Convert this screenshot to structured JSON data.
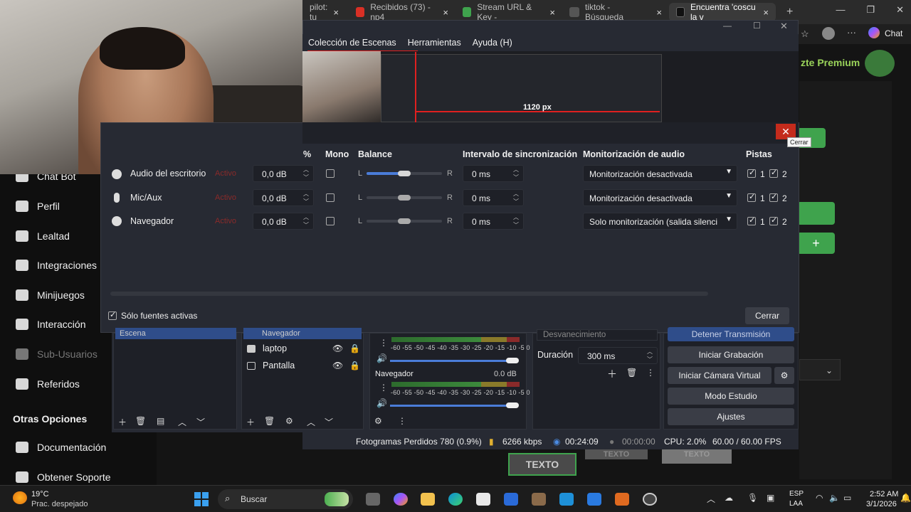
{
  "browser": {
    "tabs": [
      {
        "label": "pilot: tu",
        "active": false
      },
      {
        "label": "Recibidos (73) - np4",
        "active": false
      },
      {
        "label": "Stream URL & Key -",
        "active": false
      },
      {
        "label": "tiktok - Búsqueda",
        "active": false
      },
      {
        "label": "Encuentra 'coscu la v",
        "active": true
      }
    ],
    "new_tab": "+",
    "chat_label": "Chat"
  },
  "site": {
    "premium_label": "zte Premium",
    "sidebar": [
      {
        "label": "Chat Bot",
        "icon": "robot-icon"
      },
      {
        "label": "Perfil",
        "icon": "profile-icon"
      },
      {
        "label": "Lealtad",
        "icon": "trophy-icon"
      },
      {
        "label": "Integraciones",
        "icon": "integrations-icon"
      },
      {
        "label": "Minijuegos",
        "icon": "gamepad-icon"
      },
      {
        "label": "Interacción",
        "icon": "interaction-icon"
      },
      {
        "label": "Sub-Usuarios",
        "icon": "users-icon"
      },
      {
        "label": "Referidos",
        "icon": "referrals-icon"
      }
    ],
    "other_options_heading": "Otras Opciones",
    "other_options": [
      {
        "label": "Documentación",
        "icon": "docs-icon"
      },
      {
        "label": "Obtener Soporte",
        "icon": "help-icon"
      }
    ],
    "texto_buttons": [
      "TEXTO",
      "TEXTO",
      "TEXTO"
    ]
  },
  "obs": {
    "menu": [
      "Colección de Escenas",
      "Herramientas",
      "Ayuda (H)"
    ],
    "preview_px_label": "1120 px",
    "dialog": {
      "close_tooltip": "Cerrar",
      "headers": {
        "percent": "%",
        "mono": "Mono",
        "balance": "Balance",
        "sync": "Intervalo de sincronización",
        "monitoring": "Monitorización de audio",
        "tracks": "Pistas"
      },
      "rows": [
        {
          "name": "Audio del escritorio",
          "status": "Activo",
          "volume": "0,0 dB",
          "mono": false,
          "balance_l": "L",
          "balance_r": "R",
          "balance": 0.5,
          "sync": "0 ms",
          "monitoring": "Monitorización desactivada",
          "track1": "1",
          "track2": "2"
        },
        {
          "name": "Mic/Aux",
          "status": "Activo",
          "volume": "0,0 dB",
          "mono": false,
          "balance_l": "L",
          "balance_r": "R",
          "balance": 0.5,
          "sync": "0 ms",
          "monitoring": "Monitorización desactivada",
          "track1": "1",
          "track2": "2"
        },
        {
          "name": "Navegador",
          "status": "Activo",
          "volume": "0,0 dB",
          "mono": false,
          "balance_l": "L",
          "balance_r": "R",
          "balance": 0.5,
          "sync": "0 ms",
          "monitoring": "Solo monitorización (salida silenci",
          "track1": "1",
          "track2": "2"
        }
      ],
      "only_active_label": "Sólo fuentes activas",
      "close_button": "Cerrar"
    },
    "scenes": {
      "selected": "Escena"
    },
    "sources": [
      {
        "label": "Navegador"
      },
      {
        "label": "laptop"
      },
      {
        "label": "Pantalla"
      }
    ],
    "mixer": {
      "scale": "-60 -55 -50 -45 -40 -35 -30 -25 -20 -15 -10 -5 0",
      "channel_name": "Navegador",
      "channel_db": "0.0 dB"
    },
    "transitions": {
      "type": "Desvanecimiento",
      "duration_label": "Duración",
      "duration_value": "300 ms"
    },
    "controls": [
      "Detener Transmisión",
      "Iniciar Grabación",
      "Iniciar Cámara Virtual",
      "Modo Estudio",
      "Ajustes"
    ],
    "status": {
      "dropped": "Fotogramas Perdidos 780 (0.9%)",
      "bitrate": "6266 kbps",
      "stream_time": "00:24:09",
      "rec_time": "00:00:00",
      "cpu": "CPU: 2.0%",
      "fps": "60.00 / 60.00 FPS"
    }
  },
  "taskbar": {
    "weather_temp": "19°C",
    "weather_desc": "Prac. despejado",
    "search_placeholder": "Buscar",
    "lang_top": "ESP",
    "lang_bottom": "LAA",
    "time": "2:52 AM",
    "date": "3/1/2026"
  }
}
